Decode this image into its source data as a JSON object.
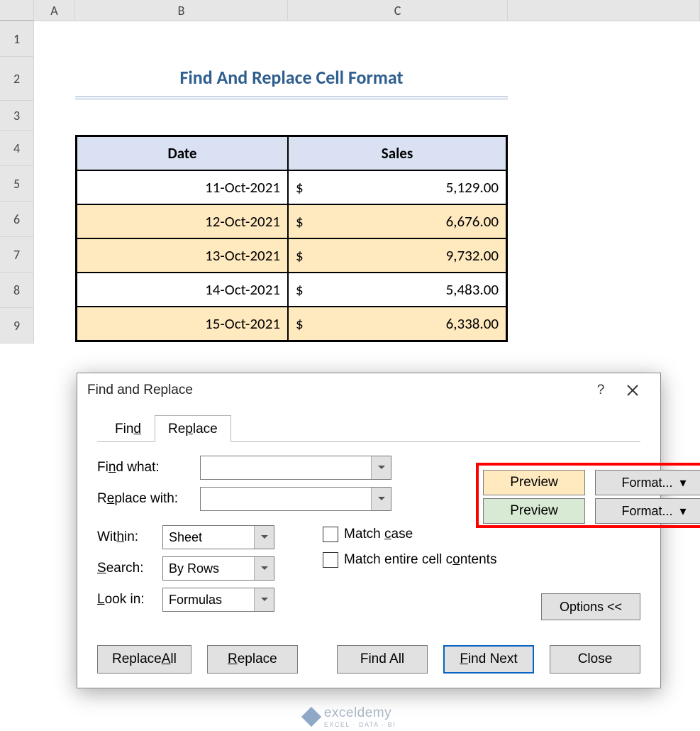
{
  "columns": [
    "A",
    "B",
    "C"
  ],
  "rows": [
    "1",
    "2",
    "3",
    "4",
    "5",
    "6",
    "7",
    "8",
    "9"
  ],
  "title": "Find And Replace Cell Format",
  "table": {
    "headers": {
      "date": "Date",
      "sales": "Sales"
    },
    "rows": [
      {
        "date": "11-Oct-2021",
        "currency": "$",
        "sales": "5,129.00",
        "highlight": false
      },
      {
        "date": "12-Oct-2021",
        "currency": "$",
        "sales": "6,676.00",
        "highlight": true
      },
      {
        "date": "13-Oct-2021",
        "currency": "$",
        "sales": "9,732.00",
        "highlight": true
      },
      {
        "date": "14-Oct-2021",
        "currency": "$",
        "sales": "5,483.00",
        "highlight": false
      },
      {
        "date": "15-Oct-2021",
        "currency": "$",
        "sales": "6,338.00",
        "highlight": true
      }
    ]
  },
  "dialog": {
    "title": "Find and Replace",
    "help": "?",
    "tabs": {
      "find": "Find",
      "replace": "Replace"
    },
    "find_what_label": "Find what:",
    "replace_with_label": "Replace with:",
    "find_what_value": "",
    "replace_with_value": "",
    "preview": "Preview",
    "format_btn": "Format...",
    "within_label": "Within:",
    "within_value": "Sheet",
    "search_label": "Search:",
    "search_value": "By Rows",
    "lookin_label": "Look in:",
    "lookin_value": "Formulas",
    "match_case": "Match case",
    "match_entire": "Match entire cell contents",
    "options": "Options <<",
    "buttons": {
      "replace_all": "Replace All",
      "replace": "Replace",
      "find_all": "Find All",
      "find_next": "Find Next",
      "close": "Close"
    }
  },
  "watermark": {
    "brand": "exceldemy",
    "tagline": "EXCEL · DATA · BI"
  }
}
